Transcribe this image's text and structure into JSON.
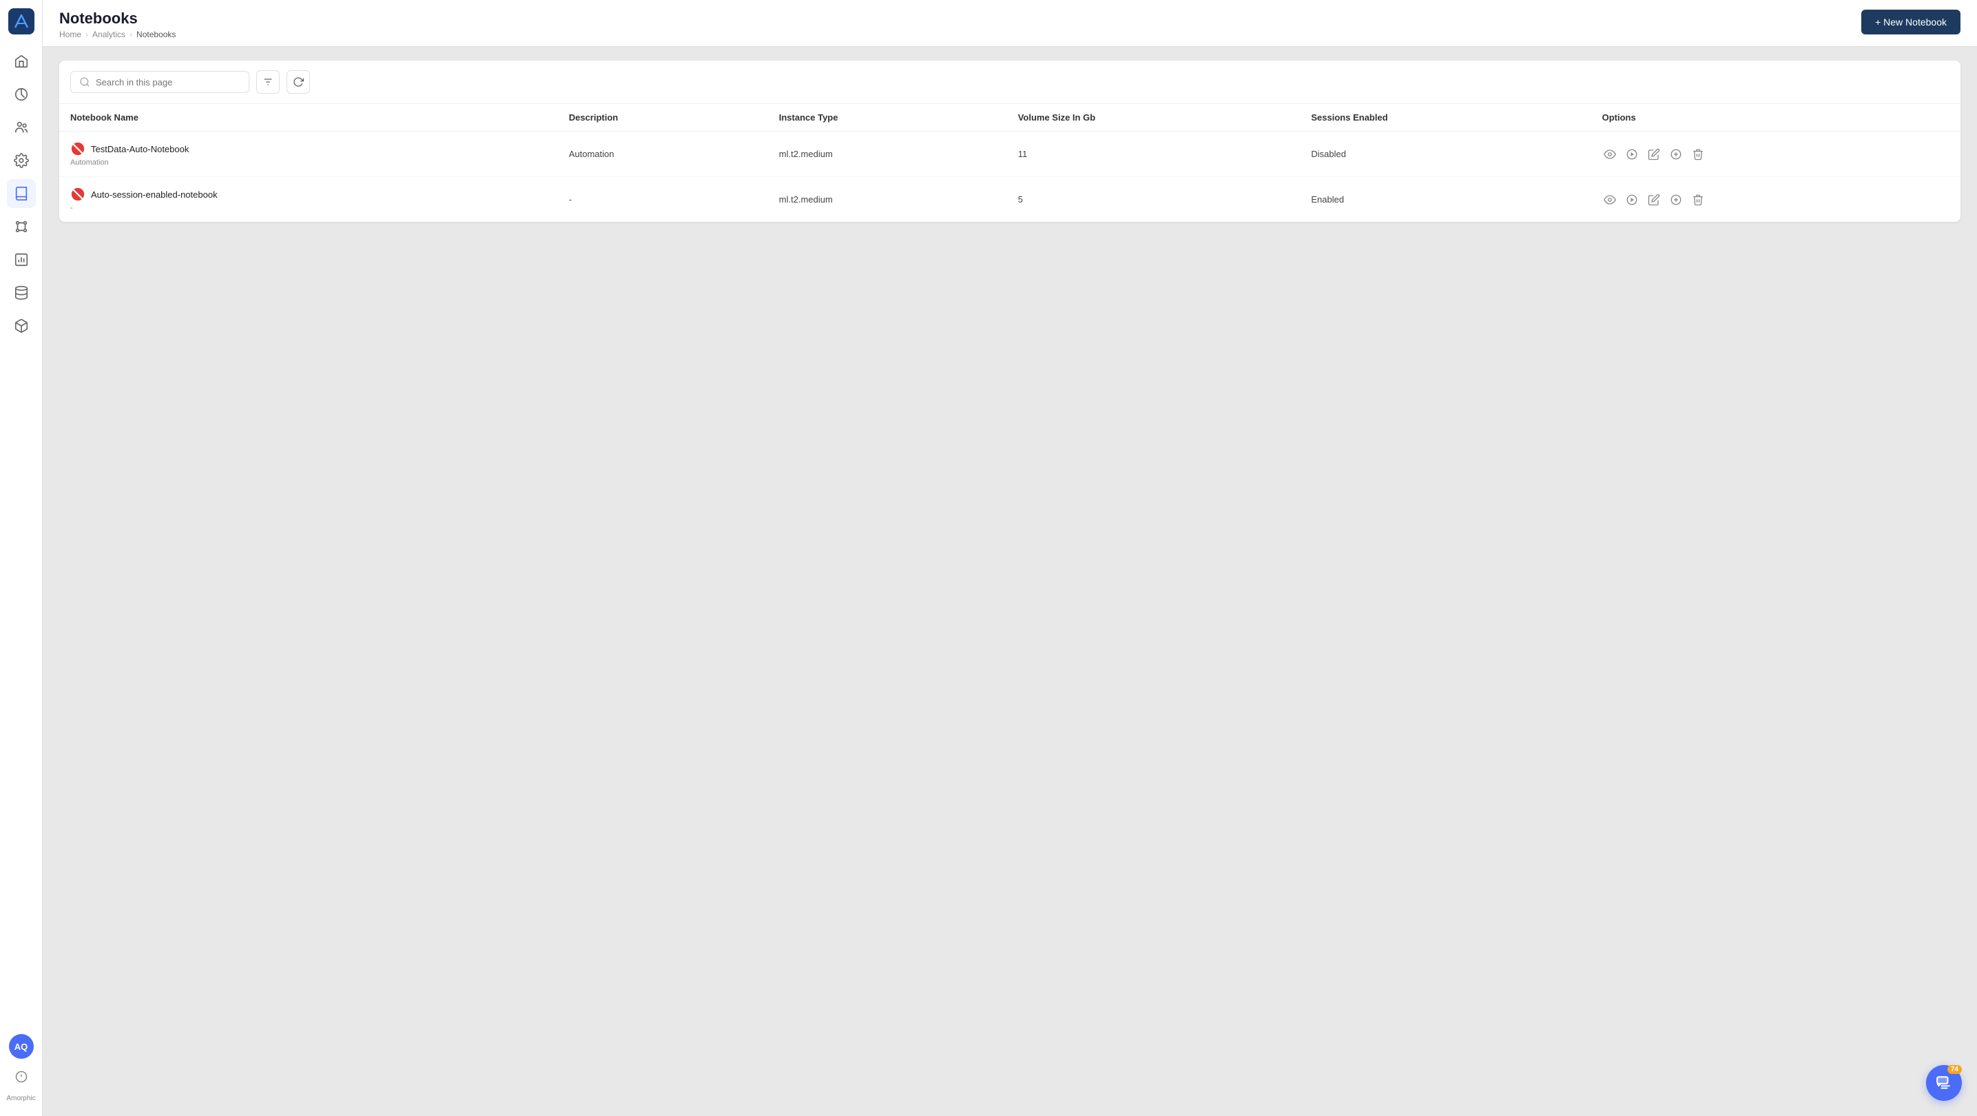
{
  "app": {
    "name": "Amorphic",
    "logo_initials": "A"
  },
  "header": {
    "title": "Notebooks",
    "breadcrumbs": [
      {
        "label": "Home",
        "href": "#"
      },
      {
        "label": "Analytics",
        "href": "#"
      },
      {
        "label": "Notebooks",
        "href": "#",
        "current": true
      }
    ],
    "new_button_label": "+ New Notebook"
  },
  "toolbar": {
    "search_placeholder": "Search in this page",
    "filter_icon": "filter-icon",
    "refresh_icon": "refresh-icon"
  },
  "table": {
    "columns": [
      {
        "key": "name",
        "label": "Notebook Name"
      },
      {
        "key": "description",
        "label": "Description"
      },
      {
        "key": "instance_type",
        "label": "Instance Type"
      },
      {
        "key": "volume_size",
        "label": "Volume Size In Gb"
      },
      {
        "key": "sessions_enabled",
        "label": "Sessions Enabled"
      },
      {
        "key": "options",
        "label": "Options"
      }
    ],
    "rows": [
      {
        "id": 1,
        "name": "TestData-Auto-Notebook",
        "tag": "Automation",
        "description": "Automation",
        "instance_type": "ml.t2.medium",
        "volume_size": "11",
        "sessions_enabled": "Disabled",
        "status": "error"
      },
      {
        "id": 2,
        "name": "Auto-session-enabled-notebook",
        "tag": "-",
        "description": "-",
        "instance_type": "ml.t2.medium",
        "volume_size": "5",
        "sessions_enabled": "Enabled",
        "status": "error"
      }
    ]
  },
  "sidebar": {
    "items": [
      {
        "id": "home",
        "icon": "home-icon",
        "label": "Home"
      },
      {
        "id": "analytics",
        "icon": "analytics-icon",
        "label": "Analytics"
      },
      {
        "id": "users",
        "icon": "users-icon",
        "label": "Users"
      },
      {
        "id": "settings",
        "icon": "settings-icon",
        "label": "Settings"
      },
      {
        "id": "notebooks",
        "icon": "notebooks-icon",
        "label": "Notebooks",
        "active": true
      },
      {
        "id": "pipelines",
        "icon": "pipelines-icon",
        "label": "Pipelines"
      },
      {
        "id": "reports",
        "icon": "reports-icon",
        "label": "Reports"
      },
      {
        "id": "datasets",
        "icon": "datasets-icon",
        "label": "Datasets"
      },
      {
        "id": "packages",
        "icon": "packages-icon",
        "label": "Packages"
      }
    ],
    "avatar_initials": "AQ",
    "brand_label": "Amorphic",
    "chat_badge_count": "74"
  }
}
